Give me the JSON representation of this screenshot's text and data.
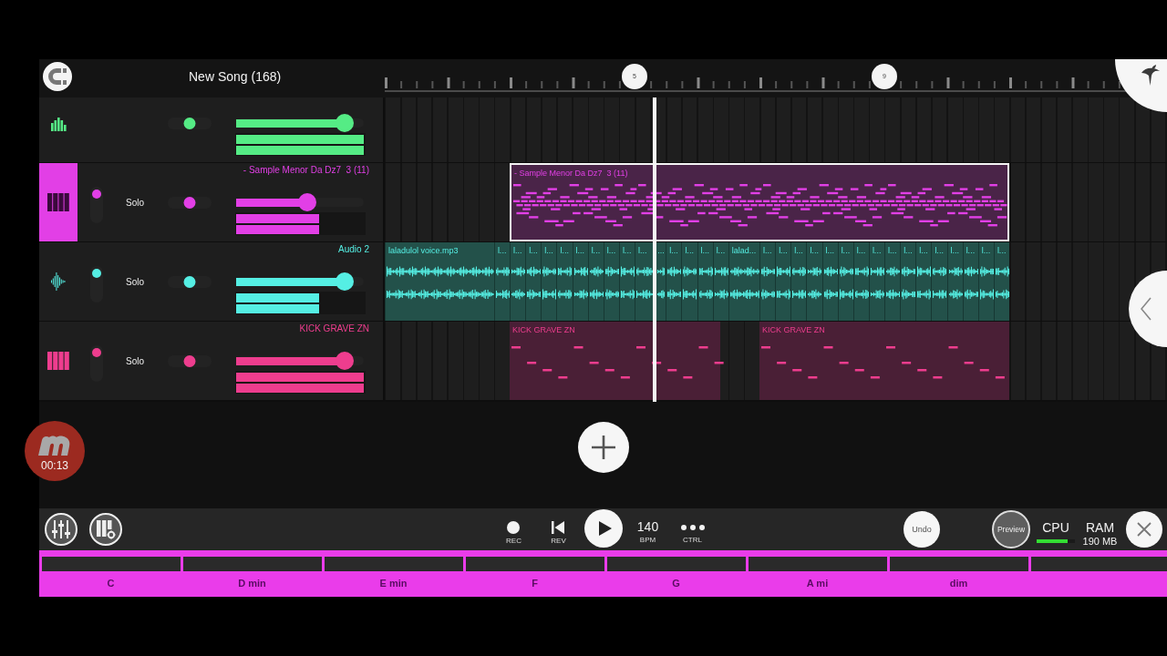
{
  "top_bar": {
    "title": "New Song (168)"
  },
  "ruler": {
    "markers": [
      {
        "label": "5"
      },
      {
        "label": "9"
      }
    ]
  },
  "tracks": [
    {
      "kind": "master",
      "color": "#55ec85",
      "selected": false,
      "pan": {
        "level": 0.5
      },
      "volume": {
        "level": 0.85
      },
      "meters": [
        {
          "level": 1
        },
        {
          "level": 1
        }
      ]
    },
    {
      "kind": "instrument",
      "name": "- Sample Menor Da Dz7  3 (11)",
      "color": "#e23fe6",
      "selected": true,
      "switch": {
        "on": true
      },
      "solo": "Solo",
      "pan": {
        "level": 0.5
      },
      "volume": {
        "level": 0.56
      },
      "meters": [
        {
          "level": 0.65
        },
        {
          "level": 0.65
        }
      ],
      "clips": [
        {
          "kind": "melody",
          "label": "- Sample Menor Da Dz7  3 (11)",
          "selected": true
        }
      ]
    },
    {
      "kind": "audio",
      "name": "Audio 2",
      "color": "#55efe4",
      "selected": false,
      "switch": {
        "on": true
      },
      "solo": "Solo",
      "pan": {
        "level": 0.5
      },
      "volume": {
        "level": 0.85
      },
      "meters": [
        {
          "level": 0.65
        },
        {
          "level": 0.65
        }
      ],
      "clips": [
        {
          "kind": "audio",
          "label": "laladulol voice.mp3",
          "selected": false
        },
        {
          "kind": "audio",
          "label": "l...",
          "selected": false
        },
        {
          "kind": "audio",
          "label": "l...",
          "selected": false
        },
        {
          "kind": "audio",
          "label": "l...",
          "selected": false
        },
        {
          "kind": "audio",
          "label": "l...",
          "selected": false
        },
        {
          "kind": "audio",
          "label": "l...",
          "selected": false
        },
        {
          "kind": "audio",
          "label": "l...",
          "selected": false
        },
        {
          "kind": "audio",
          "label": "l...",
          "selected": false
        },
        {
          "kind": "audio",
          "label": "l...",
          "selected": false
        },
        {
          "kind": "audio",
          "label": "l...",
          "selected": false
        },
        {
          "kind": "audio",
          "label": "l...",
          "selected": false
        },
        {
          "kind": "audio",
          "label": "...",
          "selected": false
        },
        {
          "kind": "audio",
          "label": "l...",
          "selected": false
        },
        {
          "kind": "audio",
          "label": "l...",
          "selected": false
        },
        {
          "kind": "audio",
          "label": "l...",
          "selected": false
        },
        {
          "kind": "audio",
          "label": "l...",
          "selected": false
        },
        {
          "kind": "audio",
          "label": "lalad...",
          "selected": false
        },
        {
          "kind": "audio",
          "label": "l...",
          "selected": false
        },
        {
          "kind": "audio",
          "label": "l...",
          "selected": false
        },
        {
          "kind": "audio",
          "label": "l...",
          "selected": false
        },
        {
          "kind": "audio",
          "label": "l...",
          "selected": false
        },
        {
          "kind": "audio",
          "label": "l...",
          "selected": false
        },
        {
          "kind": "audio",
          "label": "l...",
          "selected": false
        },
        {
          "kind": "audio",
          "label": "l...",
          "selected": false
        },
        {
          "kind": "audio",
          "label": "l...",
          "selected": false
        },
        {
          "kind": "audio",
          "label": "l...",
          "selected": false
        },
        {
          "kind": "audio",
          "label": "l...",
          "selected": false
        },
        {
          "kind": "audio",
          "label": "l...",
          "selected": false
        },
        {
          "kind": "audio",
          "label": "l...",
          "selected": false
        },
        {
          "kind": "audio",
          "label": "l...",
          "selected": false
        },
        {
          "kind": "audio",
          "label": "l...",
          "selected": false
        },
        {
          "kind": "audio",
          "label": "l...",
          "selected": false
        },
        {
          "kind": "audio",
          "label": "l...",
          "selected": false
        }
      ]
    },
    {
      "kind": "instrument",
      "name": "KICK GRAVE ZN",
      "color": "#ee3d8e",
      "selected": false,
      "switch": {
        "on": true
      },
      "solo": "Solo",
      "pan": {
        "level": 0.5
      },
      "volume": {
        "level": 0.85
      },
      "meters": [
        {
          "level": 1
        },
        {
          "level": 1
        }
      ],
      "clips": [
        {
          "kind": "drums",
          "label": "KICK GRAVE ZN",
          "selected": false
        },
        {
          "kind": "drums",
          "label": "KICK GRAVE ZN",
          "selected": false
        }
      ]
    }
  ],
  "playhead": {
    "level": 0.343
  },
  "toolbar": {
    "transport": [
      {
        "kind": "record",
        "label": "REC"
      },
      {
        "kind": "rewind",
        "label": "REV"
      },
      {
        "kind": "play"
      },
      {
        "kind": "tempo",
        "value": "140",
        "label": "BPM"
      },
      {
        "kind": "more",
        "label": "CTRL"
      }
    ],
    "undo": "Undo",
    "preview": "Preview",
    "cpu": {
      "label": "CPU",
      "level": 0.8
    },
    "ram": {
      "label": "RAM",
      "value": "190 MB"
    }
  },
  "chords": [
    {
      "kind": "chord",
      "label": "C"
    },
    {
      "kind": "chord",
      "label": "D min"
    },
    {
      "kind": "chord",
      "label": "E min"
    },
    {
      "kind": "chord",
      "label": "F"
    },
    {
      "kind": "chord",
      "label": "G"
    },
    {
      "kind": "chord",
      "label": "A mi"
    },
    {
      "kind": "chord",
      "label": "dim"
    },
    {
      "kind": "strip"
    }
  ],
  "recorder_bubble": {
    "time": "00:13"
  }
}
